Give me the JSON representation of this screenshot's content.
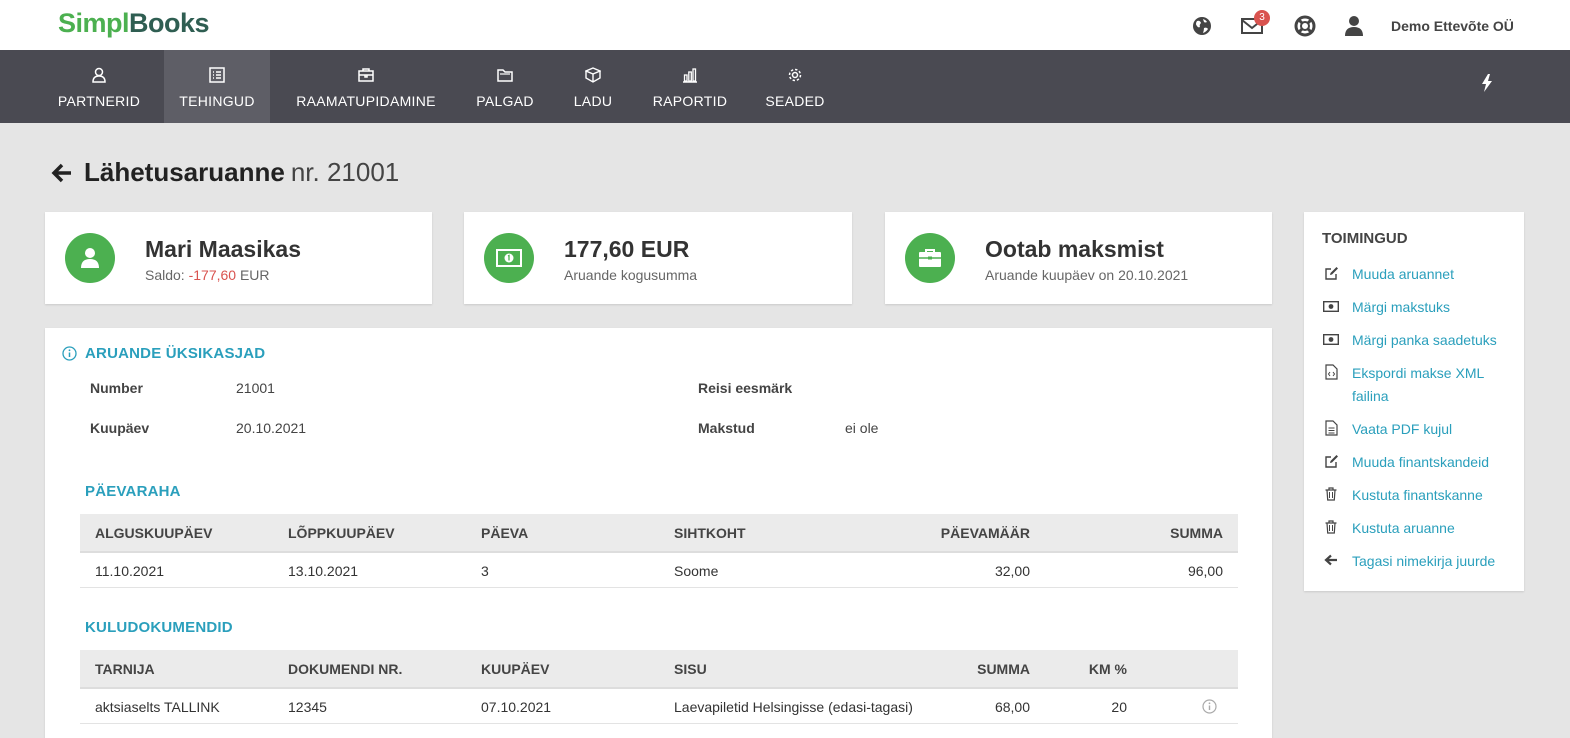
{
  "app": {
    "logo_part1": "Simpl",
    "logo_part2": "Books",
    "company": "Demo Ettevõte OÜ",
    "mail_count": "3",
    "icons": [
      "globe-icon",
      "mail-icon",
      "lifebuoy-icon",
      "user-icon"
    ]
  },
  "nav": {
    "items": [
      {
        "label": "PARTNERID",
        "icon": "user-icon"
      },
      {
        "label": "TEHINGUD",
        "icon": "list-icon"
      },
      {
        "label": "RAAMATUPIDAMINE",
        "icon": "briefcase-icon"
      },
      {
        "label": "PALGAD",
        "icon": "folder-icon"
      },
      {
        "label": "LADU",
        "icon": "box-icon"
      },
      {
        "label": "RAPORTID",
        "icon": "bar-chart-icon"
      },
      {
        "label": "SEADED",
        "icon": "gear-icon"
      }
    ],
    "active_index": 1
  },
  "page": {
    "title": "Lähetusaruanne",
    "number": "nr. 21001"
  },
  "summary": {
    "person": {
      "name": "Mari Maasikas",
      "saldo_label": "Saldo:",
      "saldo_value": "-177,60",
      "saldo_currency": "EUR"
    },
    "total": {
      "amount": "177,60 EUR",
      "caption": "Aruande kogusumma"
    },
    "status": {
      "text": "Ootab maksmist",
      "caption": "Aruande kuupäev on 20.10.2021"
    }
  },
  "details": {
    "heading": "ARUANDE ÜKSIKASJAD",
    "number_label": "Number",
    "number_value": "21001",
    "date_label": "Kuupäev",
    "date_value": "20.10.2021",
    "purpose_label": "Reisi eesmärk",
    "purpose_value": "",
    "paid_label": "Makstud",
    "paid_value": "ei ole"
  },
  "per_diem": {
    "heading": "PÄEVARAHA",
    "columns": [
      "ALGUSKUUPÄEV",
      "LÕPPKUUPÄEV",
      "PÄEVA",
      "SIHTKOHT",
      "PÄEVAMÄÄR",
      "SUMMA"
    ],
    "rows": [
      [
        "11.10.2021",
        "13.10.2021",
        "3",
        "Soome",
        "32,00",
        "96,00"
      ]
    ]
  },
  "expenses": {
    "heading": "KULUDOKUMENDID",
    "columns": [
      "TARNIJA",
      "DOKUMENDI NR.",
      "KUUPÄEV",
      "SISU",
      "SUMMA",
      "KM %"
    ],
    "rows": [
      [
        "aktsiaselts TALLINK",
        "12345",
        "07.10.2021",
        "Laevapiletid Helsingisse (edasi-tagasi)",
        "68,00",
        "20"
      ]
    ]
  },
  "actions": {
    "title": "TOIMINGUD",
    "items": [
      {
        "label": "Muuda aruannet",
        "icon": "edit-icon"
      },
      {
        "label": "Märgi makstuks",
        "icon": "money-icon"
      },
      {
        "label": "Märgi panka saadetuks",
        "icon": "money-icon"
      },
      {
        "label": "Ekspordi makse XML failina",
        "icon": "code-file-icon"
      },
      {
        "label": "Vaata PDF kujul",
        "icon": "document-icon"
      },
      {
        "label": "Muuda finantskandeid",
        "icon": "edit-icon"
      },
      {
        "label": "Kustuta finantskanne",
        "icon": "trash-icon"
      },
      {
        "label": "Kustuta aruanne",
        "icon": "trash-icon"
      },
      {
        "label": "Tagasi nimekirja juurde",
        "icon": "arrow-left-icon"
      }
    ]
  },
  "colors": {
    "brand_green": "#4cb050",
    "brand_dark": "#2f5e52",
    "nav_bg": "#4a4a52",
    "accent_blue": "#2a9fbc",
    "negative": "#d9534f"
  }
}
